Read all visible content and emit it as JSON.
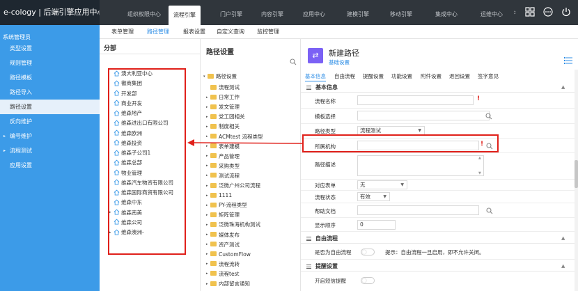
{
  "app": {
    "title": "e-cology | 后端引擎应用中心"
  },
  "topnav": {
    "items": [
      "组织权限中心",
      "流程引擎",
      "门户引擎",
      "内容引擎",
      "应用中心",
      "建模引擎",
      "移动引擎",
      "集成中心",
      "运维中心"
    ],
    "active_index": 1,
    "more": "›"
  },
  "sidebar": {
    "user": "系统管理员",
    "items": [
      {
        "label": "类型设置",
        "arrow": ""
      },
      {
        "label": "规则管理",
        "arrow": ""
      },
      {
        "label": "路径模板",
        "arrow": ""
      },
      {
        "label": "路径导入",
        "arrow": ""
      },
      {
        "label": "路径设置",
        "arrow": ""
      },
      {
        "label": "反向维护",
        "arrow": ""
      },
      {
        "label": "编号维护",
        "arrow": "▸"
      },
      {
        "label": "流程测试",
        "arrow": "▸"
      },
      {
        "label": "应用设置",
        "arrow": ""
      }
    ],
    "active_index": 4
  },
  "subnav": {
    "items": [
      "表单管理",
      "路径管理",
      "报表设置",
      "自定义查询",
      "监控管理"
    ],
    "active_index": 1
  },
  "departments": {
    "title": "分部",
    "items": [
      {
        "label": "澳大利亚中心",
        "exp": ""
      },
      {
        "label": "徽商集团",
        "exp": ""
      },
      {
        "label": "开发部",
        "exp": ""
      },
      {
        "label": "商业开发",
        "exp": ""
      },
      {
        "label": "维森地产",
        "exp": ""
      },
      {
        "label": "维森进出口有限公司",
        "exp": ""
      },
      {
        "label": "维森欧洲",
        "exp": ""
      },
      {
        "label": "维森投资",
        "exp": ""
      },
      {
        "label": "维森子公司1",
        "exp": ""
      },
      {
        "label": "维森总部",
        "exp": ""
      },
      {
        "label": "物业管理",
        "exp": ""
      },
      {
        "label": "维森汽车物资有限公司",
        "exp": ""
      },
      {
        "label": "维森国际商贸有限公司",
        "exp": ""
      },
      {
        "label": "维森中东",
        "exp": ""
      },
      {
        "label": "维森南美",
        "exp": "▸"
      },
      {
        "label": "维森公司",
        "exp": ""
      },
      {
        "label": "维森澳洲-",
        "exp": "▸"
      }
    ]
  },
  "paths": {
    "title": "路径设置",
    "root": "路径设置",
    "items": [
      {
        "label": "流程测试",
        "exp": ""
      },
      {
        "label": "日常工作",
        "exp": "▸"
      },
      {
        "label": "发文管理",
        "exp": "▸"
      },
      {
        "label": "党工团相关",
        "exp": "▸"
      },
      {
        "label": "制度相关",
        "exp": "▸"
      },
      {
        "label": "ACMtest 流程类型",
        "exp": "▸"
      },
      {
        "label": "表单建模",
        "exp": "▸"
      },
      {
        "label": "产品管理",
        "exp": "▸"
      },
      {
        "label": "采购类型",
        "exp": "▸"
      },
      {
        "label": "测试流程",
        "exp": "▸"
      },
      {
        "label": "泛微广州公司流程",
        "exp": "▸"
      },
      {
        "label": "1111",
        "exp": "▸"
      },
      {
        "label": "PY-流程类型",
        "exp": "▸"
      },
      {
        "label": "矩阵管理",
        "exp": "▸"
      },
      {
        "label": "泛微珠海机构测试",
        "exp": "▸"
      },
      {
        "label": "媒体发布",
        "exp": "▸"
      },
      {
        "label": "资产测试",
        "exp": "▸"
      },
      {
        "label": "CustomFlow",
        "exp": "▸"
      },
      {
        "label": "流程流转",
        "exp": "▸"
      },
      {
        "label": "流程test",
        "exp": "▸"
      },
      {
        "label": "内部留言通知",
        "exp": "▸"
      }
    ]
  },
  "form": {
    "title": "新建路径",
    "subtitle": "基础设置",
    "tabs": [
      "基本信息",
      "自由流程",
      "提醒设置",
      "功能设置",
      "附件设置",
      "退回设置",
      "签字意见"
    ],
    "active_tab": 0,
    "sections": {
      "basic": "基本信息",
      "free": "自由流程",
      "remind": "提醒设置"
    },
    "fields": {
      "name": {
        "label": "流程名称",
        "value": ""
      },
      "template": {
        "label": "模板选择",
        "value": ""
      },
      "type": {
        "label": "路径类型",
        "value": "流程测试"
      },
      "org": {
        "label": "所属机构",
        "value": ""
      },
      "desc": {
        "label": "路径描述",
        "value": ""
      },
      "form_link": {
        "label": "对应表单",
        "value": "无"
      },
      "status": {
        "label": "流程状态",
        "value": "有效"
      },
      "help": {
        "label": "帮助文档",
        "value": ""
      },
      "order": {
        "label": "显示顺序",
        "value": "0"
      }
    },
    "free_flow": {
      "label": "是否为自由流程",
      "hint": "提示：自由流程一旦启用，即不允许关闭。"
    },
    "remind": {
      "label": "开启短信提醒"
    }
  },
  "colors": {
    "sidebar": "#3c9be8",
    "topbar": "#30363c",
    "accent": "#2e8ee6",
    "highlight": "#e0201a"
  }
}
